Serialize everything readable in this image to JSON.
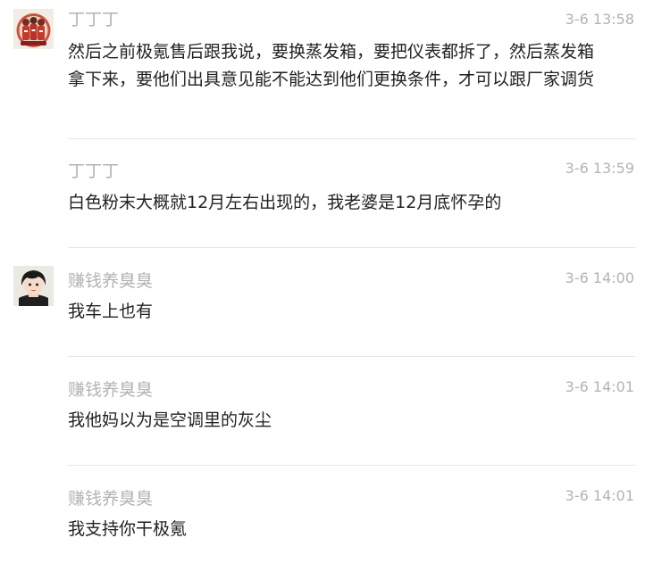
{
  "comments": [
    {
      "username": "丁丁丁",
      "time": "3-6 13:58",
      "text": "然后之前极氪售后跟我说，要换蒸发箱，要把仪表都拆了，然后蒸发箱拿下来，要他们出具意见能不能达到他们更换条件，才可以跟厂家调货",
      "avatar": "basketball-team-avatar-icon"
    },
    {
      "username": "丁丁丁",
      "time": "3-6 13:59",
      "text": "白色粉末大概就12月左右出现的，我老婆是12月底怀孕的"
    },
    {
      "username": "赚钱养臭臭",
      "time": "3-6 14:00",
      "text": "我车上也有",
      "avatar": "dark-hair-person-avatar-icon"
    },
    {
      "username": "赚钱养臭臭",
      "time": "3-6 14:01",
      "text": "我他妈以为是空调里的灰尘"
    },
    {
      "username": "赚钱养臭臭",
      "time": "3-6 14:01",
      "text": "我支持你干极氪"
    }
  ]
}
